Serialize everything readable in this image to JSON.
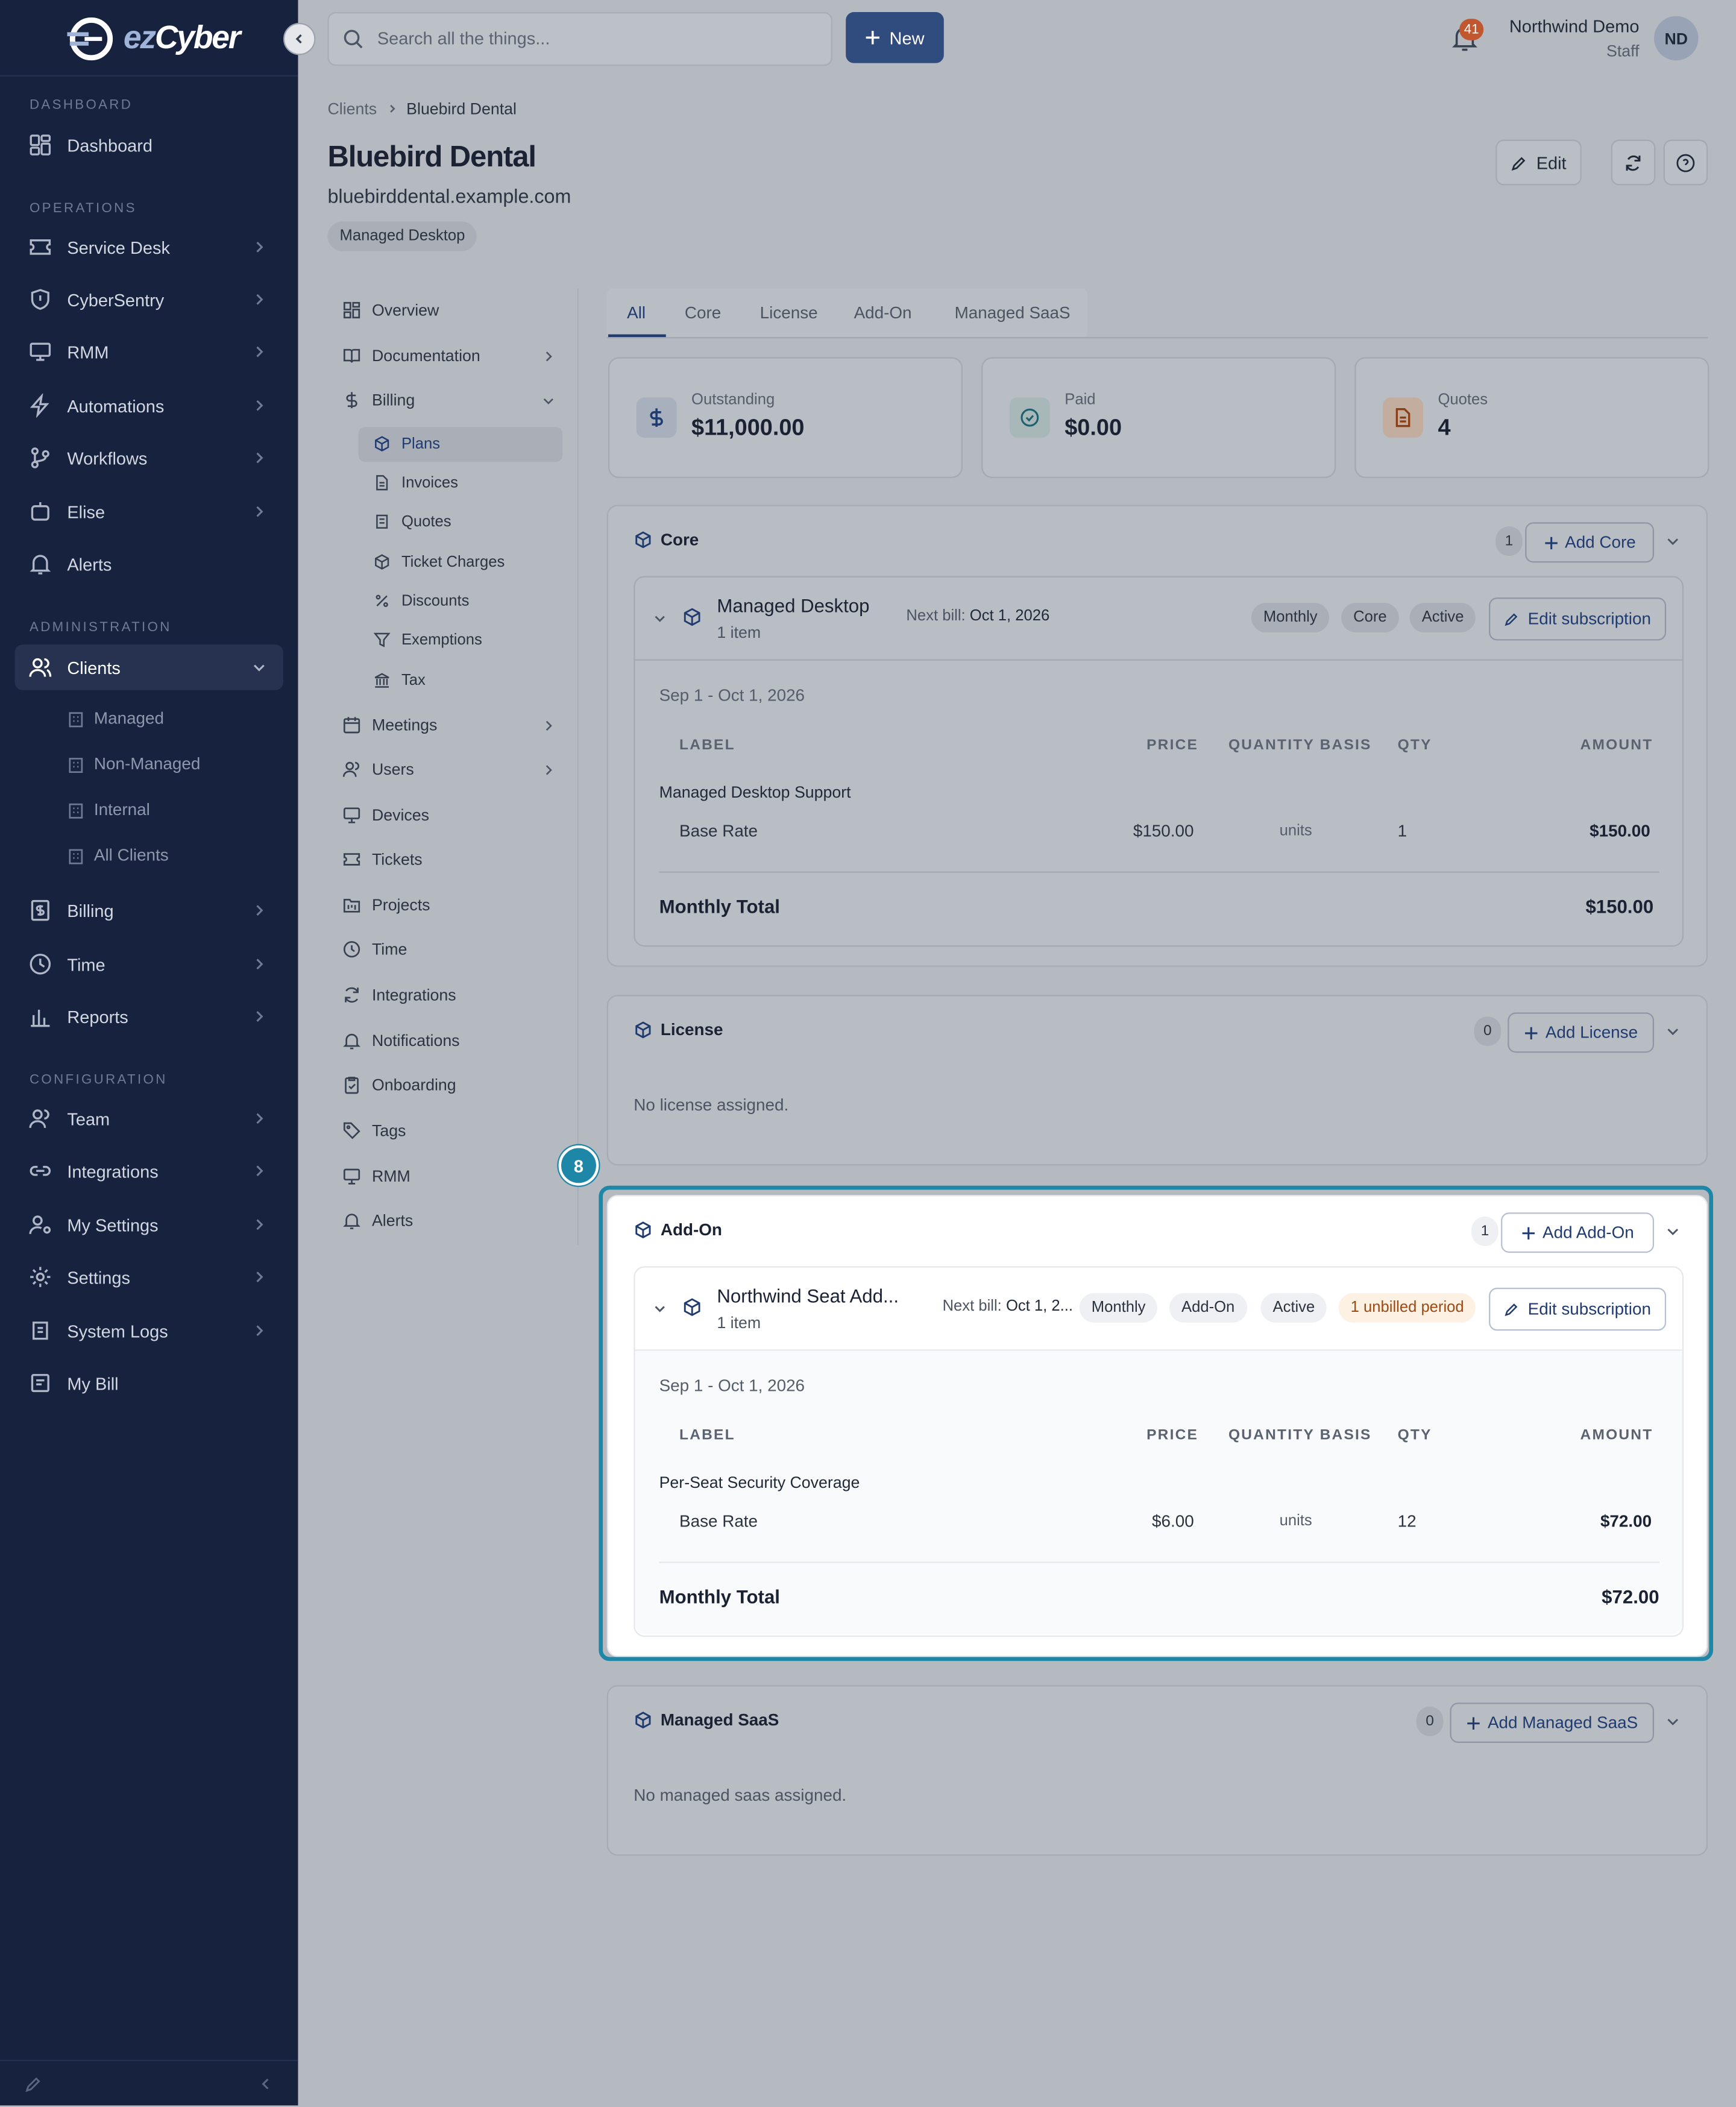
{
  "brand": {
    "logo_text_a": "ez",
    "logo_text_b": "Cyber"
  },
  "sidebar": {
    "sections": {
      "dashboard": "DASHBOARD",
      "operations": "OPERATIONS",
      "administration": "ADMINISTRATION",
      "configuration": "CONFIGURATION"
    },
    "items": {
      "dashboard": "Dashboard",
      "service_desk": "Service Desk",
      "cybersentry": "CyberSentry",
      "rmm": "RMM",
      "automations": "Automations",
      "workflows": "Workflows",
      "elise": "Elise",
      "alerts": "Alerts",
      "clients": "Clients",
      "billing": "Billing",
      "time": "Time",
      "reports": "Reports",
      "team": "Team",
      "integrations": "Integrations",
      "my_settings": "My Settings",
      "settings": "Settings",
      "system_logs": "System Logs",
      "my_bill": "My Bill"
    },
    "clients_sub": {
      "managed": "Managed",
      "non_managed": "Non-Managed",
      "internal": "Internal",
      "all": "All Clients"
    }
  },
  "topbar": {
    "search_placeholder": "Search all the things...",
    "new_label": "New",
    "notifications_count": "41",
    "user_name": "Northwind Demo",
    "user_role": "Staff",
    "avatar_initials": "ND"
  },
  "breadcrumb": {
    "parent": "Clients",
    "current": "Bluebird Dental"
  },
  "client": {
    "name": "Bluebird Dental",
    "domain": "bluebirddental.example.com",
    "plan_tag": "Managed Desktop",
    "edit_label": "Edit"
  },
  "subnav": {
    "overview": "Overview",
    "documentation": "Documentation",
    "billing": "Billing",
    "plans": "Plans",
    "invoices": "Invoices",
    "quotes": "Quotes",
    "ticket_charges": "Ticket Charges",
    "discounts": "Discounts",
    "exemptions": "Exemptions",
    "tax": "Tax",
    "meetings": "Meetings",
    "users": "Users",
    "devices": "Devices",
    "tickets": "Tickets",
    "projects": "Projects",
    "time": "Time",
    "integrations": "Integrations",
    "notifications": "Notifications",
    "onboarding": "Onboarding",
    "tags": "Tags",
    "rmm": "RMM",
    "alerts": "Alerts"
  },
  "tabs": {
    "all": "All",
    "core": "Core",
    "license": "License",
    "addon": "Add-On",
    "saas": "Managed SaaS"
  },
  "stats": {
    "outstanding_label": "Outstanding",
    "outstanding_value": "$11,000.00",
    "paid_label": "Paid",
    "paid_value": "$0.00",
    "quotes_label": "Quotes",
    "quotes_value": "4"
  },
  "table_headers": {
    "label": "LABEL",
    "price": "PRICE",
    "basis": "QUANTITY BASIS",
    "qty": "QTY",
    "amount": "AMOUNT"
  },
  "core": {
    "title": "Core",
    "count": "1",
    "add_label": "Add Core",
    "sub": {
      "name": "Managed Desktop",
      "items": "1 item",
      "next_bill_label": "Next bill:",
      "next_bill": "Oct 1, 2026",
      "pills": [
        "Monthly",
        "Core",
        "Active"
      ],
      "edit_label": "Edit subscription",
      "period": "Sep 1 - Oct 1, 2026",
      "group": "Managed Desktop Support",
      "row": {
        "label": "Base Rate",
        "price": "$150.00",
        "basis": "units",
        "qty": "1",
        "amount": "$150.00"
      },
      "total_label": "Monthly Total",
      "total": "$150.00"
    }
  },
  "license": {
    "title": "License",
    "count": "0",
    "add_label": "Add License",
    "empty": "No license assigned."
  },
  "addon": {
    "title": "Add-On",
    "count": "1",
    "add_label": "Add Add-On",
    "step_marker": "8",
    "sub": {
      "name": "Northwind Seat Add...",
      "items": "1 item",
      "next_bill_label": "Next bill:",
      "next_bill": "Oct 1, 2...",
      "pills": [
        "Monthly",
        "Add-On",
        "Active"
      ],
      "warn_pill": "1 unbilled period",
      "edit_label": "Edit subscription",
      "period": "Sep 1 - Oct 1, 2026",
      "group": "Per-Seat Security Coverage",
      "row": {
        "label": "Base Rate",
        "price": "$6.00",
        "basis": "units",
        "qty": "12",
        "amount": "$72.00"
      },
      "total_label": "Monthly Total",
      "total": "$72.00"
    }
  },
  "saas": {
    "title": "Managed SaaS",
    "count": "0",
    "add_label": "Add Managed SaaS",
    "empty": "No managed saas assigned."
  }
}
